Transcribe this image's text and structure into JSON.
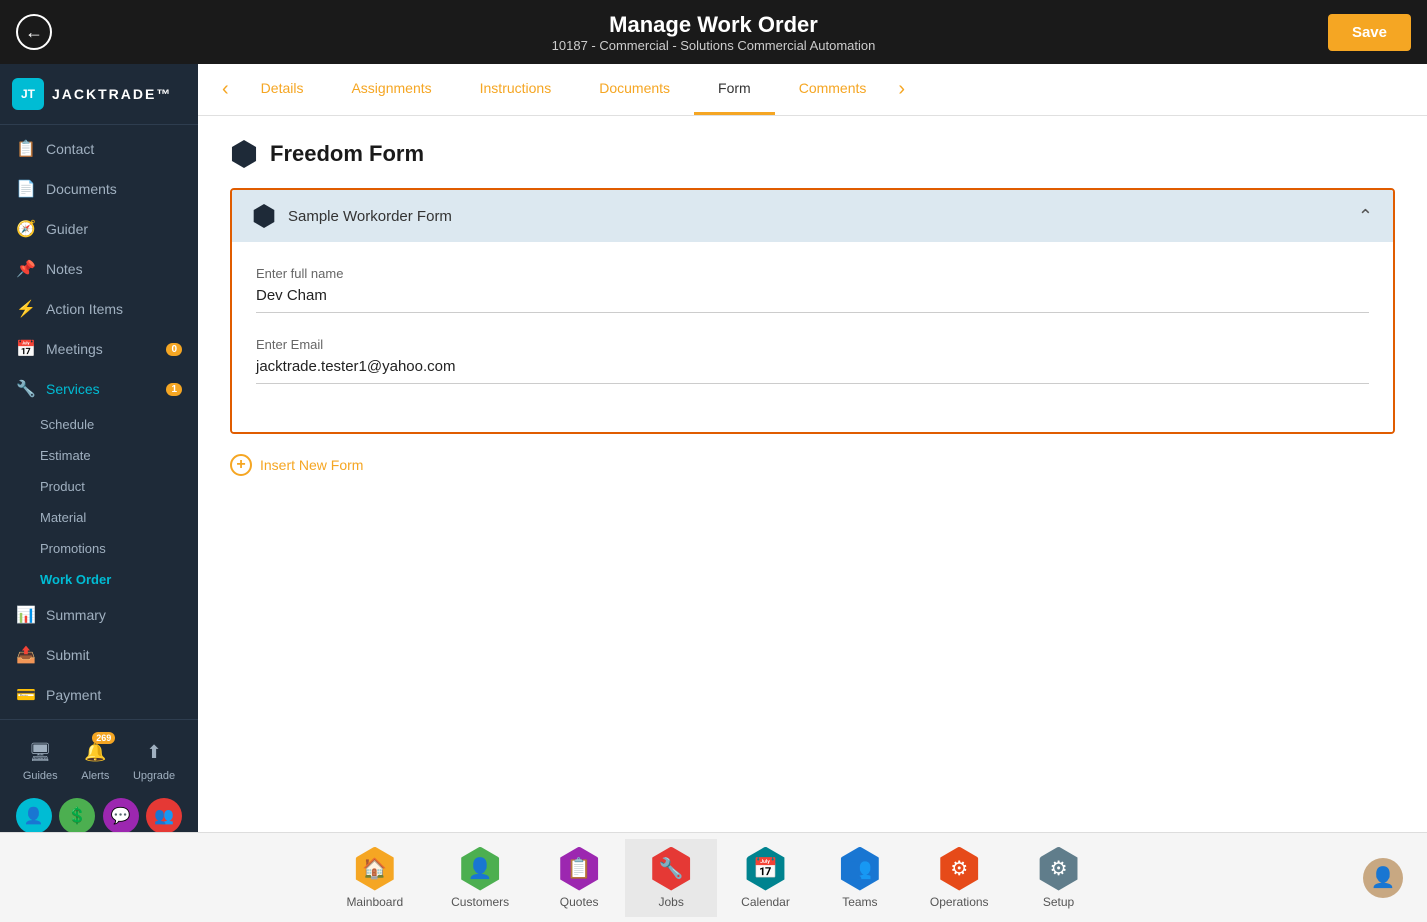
{
  "header": {
    "title": "Manage Work Order",
    "subtitle": "10187 - Commercial - Solutions Commercial Automation",
    "back_label": "←",
    "save_label": "Save"
  },
  "tabs": [
    {
      "id": "details",
      "label": "Details",
      "active": false
    },
    {
      "id": "assignments",
      "label": "Assignments",
      "active": false
    },
    {
      "id": "instructions",
      "label": "Instructions",
      "active": false
    },
    {
      "id": "documents",
      "label": "Documents",
      "active": false
    },
    {
      "id": "form",
      "label": "Form",
      "active": true
    },
    {
      "id": "comments",
      "label": "Comments",
      "active": false
    }
  ],
  "sidebar": {
    "logo": "JACKTRADE™",
    "nav_items": [
      {
        "id": "contact",
        "label": "Contact",
        "icon": "📋"
      },
      {
        "id": "documents",
        "label": "Documents",
        "icon": "📄"
      },
      {
        "id": "guider",
        "label": "Guider",
        "icon": "🧭"
      },
      {
        "id": "notes",
        "label": "Notes",
        "icon": "📌"
      },
      {
        "id": "action-items",
        "label": "Action Items",
        "icon": "⚡"
      },
      {
        "id": "meetings",
        "label": "Meetings",
        "icon": "📅",
        "badge": "0"
      },
      {
        "id": "services",
        "label": "Services",
        "icon": "🔧",
        "badge": "1",
        "active": true
      }
    ],
    "sub_nav_items": [
      {
        "id": "schedule",
        "label": "Schedule"
      },
      {
        "id": "estimate",
        "label": "Estimate"
      },
      {
        "id": "product",
        "label": "Product"
      },
      {
        "id": "material",
        "label": "Material"
      },
      {
        "id": "promotions",
        "label": "Promotions"
      },
      {
        "id": "work-order",
        "label": "Work Order",
        "active": true
      }
    ],
    "more_nav": [
      {
        "id": "summary",
        "label": "Summary",
        "icon": "📊"
      },
      {
        "id": "submit",
        "label": "Submit",
        "icon": "📤"
      },
      {
        "id": "payment",
        "label": "Payment",
        "icon": "💳"
      }
    ],
    "bottom_btns": [
      {
        "id": "guides",
        "label": "Guides",
        "icon": "🖥"
      },
      {
        "id": "alerts",
        "label": "Alerts",
        "icon": "🔔",
        "badge": "269"
      },
      {
        "id": "upgrade",
        "label": "Upgrade",
        "icon": "⬆"
      }
    ],
    "user_icons": [
      {
        "id": "person",
        "icon": "👤",
        "bg": "#00bcd4"
      },
      {
        "id": "dollar",
        "icon": "💲",
        "bg": "#4caf50"
      },
      {
        "id": "chat",
        "icon": "💬",
        "bg": "#9c27b0"
      },
      {
        "id": "group",
        "icon": "👥",
        "bg": "#e53935"
      }
    ]
  },
  "form_section": {
    "title": "Freedom Form",
    "card_title": "Sample Workorder Form",
    "fields": [
      {
        "id": "full-name",
        "label": "Enter full name",
        "value": "Dev Cham"
      },
      {
        "id": "email",
        "label": "Enter Email",
        "value": "jacktrade.tester1@yahoo.com"
      }
    ],
    "insert_btn_label": "Insert New Form"
  },
  "bottom_nav": [
    {
      "id": "mainboard",
      "label": "Mainboard",
      "icon": "🏠",
      "hex": "hex-yellow"
    },
    {
      "id": "customers",
      "label": "Customers",
      "icon": "👤",
      "hex": "hex-green"
    },
    {
      "id": "quotes",
      "label": "Quotes",
      "icon": "📋",
      "hex": "hex-purple"
    },
    {
      "id": "jobs",
      "label": "Jobs",
      "icon": "🔧",
      "hex": "hex-red",
      "active": true
    },
    {
      "id": "calendar",
      "label": "Calendar",
      "icon": "📅",
      "hex": "hex-teal"
    },
    {
      "id": "teams",
      "label": "Teams",
      "icon": "👥",
      "hex": "hex-blue"
    },
    {
      "id": "operations",
      "label": "Operations",
      "icon": "⚙",
      "hex": "hex-orange"
    },
    {
      "id": "setup",
      "label": "Setup",
      "icon": "⚙",
      "hex": "hex-gray"
    }
  ]
}
